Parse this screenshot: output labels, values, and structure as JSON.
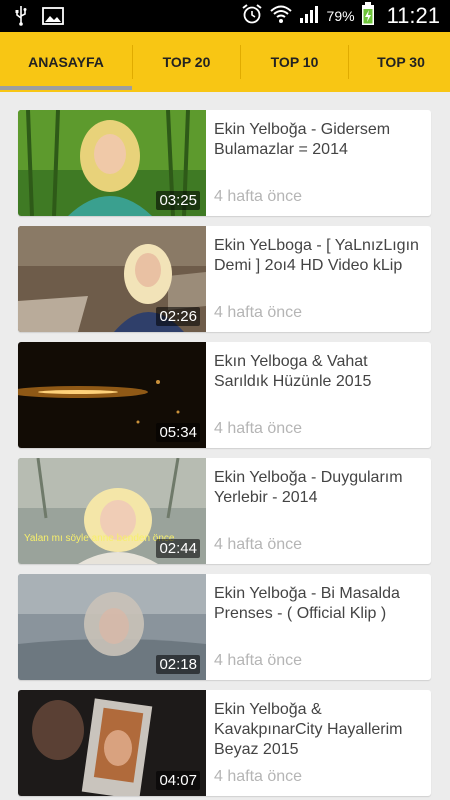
{
  "status_bar": {
    "battery_percent": "79%",
    "time": "11:21",
    "icons": [
      "usb-icon",
      "image-icon",
      "alarm-icon",
      "wifi-icon",
      "signal-icon",
      "battery-charging-icon"
    ]
  },
  "tabs": [
    {
      "label": "ANASAYFA",
      "selected": true
    },
    {
      "label": "TOP 20",
      "selected": false
    },
    {
      "label": "TOP 10",
      "selected": false
    },
    {
      "label": "TOP 30",
      "selected": false
    }
  ],
  "videos": [
    {
      "title": "Ekin Yelboğa - Gidersem Bulamazlar = 2014",
      "duration": "03:25",
      "ago": "4 hafta önce"
    },
    {
      "title": "Ekin YeLboga - [ YaLnızLıgın Demi ] 2oı4 HD Video kLip",
      "duration": "02:26",
      "ago": "4 hafta önce"
    },
    {
      "title": "Ekın Yelboga &  Vahat Sarıldık Hüzünle 2015",
      "duration": "05:34",
      "ago": "4 hafta önce"
    },
    {
      "title": "Ekin Yelboğa - Duygularım Yerlebir - 2014",
      "duration": "02:44",
      "ago": "4 hafta önce",
      "overlay_text": "Yalan mı söyle anne benden önce"
    },
    {
      "title": "Ekin Yelboğa - Bi Masalda Prenses - ( Official Klip )",
      "duration": "02:18",
      "ago": "4 hafta önce"
    },
    {
      "title": "Ekin Yelboğa & KavakpınarCity  Hayallerim Beyaz 2015",
      "duration": "04:07",
      "ago": "4 hafta önce"
    }
  ],
  "colors": {
    "tab_bar": "#f8c614",
    "background": "#ececec",
    "status_bar": "#000000"
  }
}
